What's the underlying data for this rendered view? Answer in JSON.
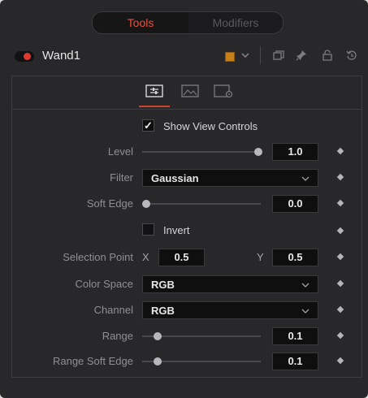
{
  "top_tabs": [
    {
      "label": "Tools",
      "active": true
    },
    {
      "label": "Modifiers",
      "active": false
    }
  ],
  "header": {
    "node_name": "Wand1",
    "swatch_color": "#c77f1a",
    "icons": [
      "color-swatch",
      "chevron-down-icon",
      "window-icon",
      "pin-icon",
      "lock-icon",
      "reset-icon"
    ]
  },
  "subtabs": [
    {
      "icon": "controls-icon",
      "active": true
    },
    {
      "icon": "image-icon",
      "active": false
    },
    {
      "icon": "settings-icon",
      "active": false
    }
  ],
  "show_view_controls": {
    "label": "Show View Controls",
    "checked": true
  },
  "level": {
    "label": "Level",
    "value": "1.0",
    "fraction": 1.0
  },
  "filter": {
    "label": "Filter",
    "value": "Gaussian"
  },
  "soft_edge": {
    "label": "Soft Edge",
    "value": "0.0",
    "fraction": 0.0
  },
  "invert": {
    "label": "Invert",
    "checked": false
  },
  "selection_point": {
    "label": "Selection Point",
    "x_label": "X",
    "x_value": "0.5",
    "y_label": "Y",
    "y_value": "0.5"
  },
  "color_space": {
    "label": "Color Space",
    "value": "RGB"
  },
  "channel": {
    "label": "Channel",
    "value": "RGB"
  },
  "range": {
    "label": "Range",
    "value": "0.1",
    "fraction": 0.1
  },
  "range_soft_edge": {
    "label": "Range Soft Edge",
    "value": "0.1",
    "fraction": 0.1
  },
  "colors": {
    "accent": "#e2533c",
    "active_underline": "#d0442f",
    "toggle_on": "#e0392f"
  }
}
